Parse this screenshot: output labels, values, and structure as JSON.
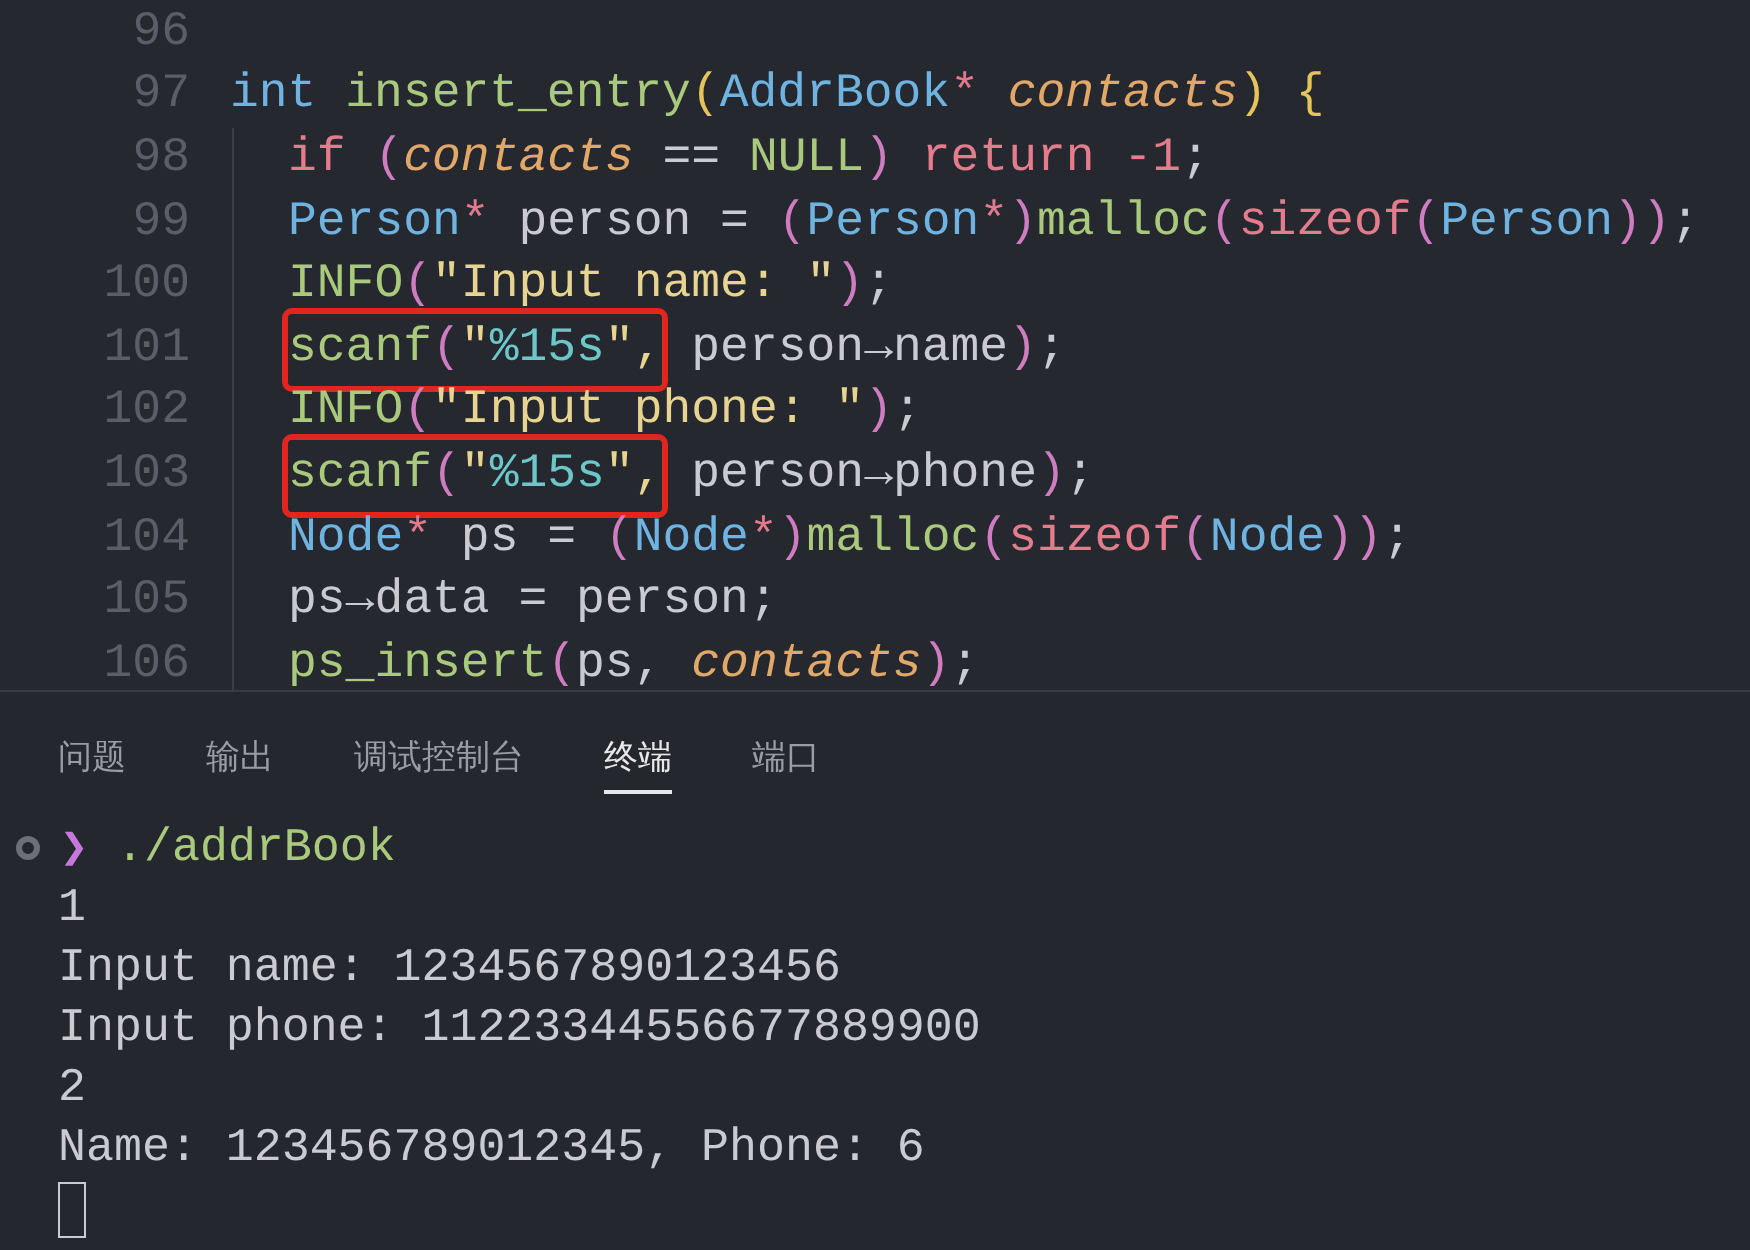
{
  "editor": {
    "lines": [
      {
        "number": "96",
        "boxed": false
      },
      {
        "number": "97",
        "boxed": false,
        "tokens": [
          {
            "text": "int ",
            "kind": "type"
          },
          {
            "text": "insert_entry",
            "kind": "fn"
          },
          {
            "text": "(",
            "kind": "bracket"
          },
          {
            "text": "AddrBook",
            "kind": "type"
          },
          {
            "text": "* ",
            "kind": "op"
          },
          {
            "text": "contacts",
            "kind": "param"
          },
          {
            "text": ") {",
            "kind": "bracket"
          }
        ],
        "children": [
          {
            "number": "98",
            "boxed": false,
            "tokens": [
              {
                "text": "if ",
                "kind": "keyword"
              },
              {
                "text": "(",
                "kind": "paren"
              },
              {
                "text": "contacts",
                "kind": "param"
              },
              {
                "text": " == ",
                "kind": "plain"
              },
              {
                "text": "NULL",
                "kind": "fn"
              },
              {
                "text": ") ",
                "kind": "paren"
              },
              {
                "text": "return -1",
                "kind": "keyword"
              },
              {
                "text": ";",
                "kind": "plain"
              }
            ]
          },
          {
            "number": "99",
            "boxed": false,
            "tokens": [
              {
                "text": "Person",
                "kind": "type"
              },
              {
                "text": "* ",
                "kind": "op"
              },
              {
                "text": "person = ",
                "kind": "plain"
              },
              {
                "text": "(",
                "kind": "paren"
              },
              {
                "text": "Person",
                "kind": "type"
              },
              {
                "text": "*",
                "kind": "op"
              },
              {
                "text": ")",
                "kind": "paren"
              },
              {
                "text": "malloc",
                "kind": "fn"
              },
              {
                "text": "(",
                "kind": "paren"
              },
              {
                "text": "sizeof",
                "kind": "keyword"
              },
              {
                "text": "(",
                "kind": "paren"
              },
              {
                "text": "Person",
                "kind": "type"
              },
              {
                "text": "))",
                "kind": "paren"
              },
              {
                "text": ";",
                "kind": "plain"
              }
            ]
          },
          {
            "number": "100",
            "boxed": false,
            "tokens": [
              {
                "text": "INFO",
                "kind": "fn"
              },
              {
                "text": "(",
                "kind": "paren"
              },
              {
                "text": "\"Input name: \"",
                "kind": "string"
              },
              {
                "text": ")",
                "kind": "paren"
              },
              {
                "text": ";",
                "kind": "plain"
              }
            ]
          },
          {
            "number": "101",
            "boxed": true,
            "boxed_tokens": [
              {
                "text": "scanf",
                "kind": "fn"
              },
              {
                "text": "(",
                "kind": "paren"
              },
              {
                "text": "\"",
                "kind": "string"
              },
              {
                "text": "%15s",
                "kind": "format"
              },
              {
                "text": "\",",
                "kind": "string"
              }
            ],
            "tokens": [
              {
                "text": " person→name",
                "kind": "plain"
              },
              {
                "text": ")",
                "kind": "paren"
              },
              {
                "text": ";",
                "kind": "plain"
              }
            ]
          },
          {
            "number": "102",
            "boxed": false,
            "tokens": [
              {
                "text": "INFO",
                "kind": "fn"
              },
              {
                "text": "(",
                "kind": "paren"
              },
              {
                "text": "\"Input phone: \"",
                "kind": "string"
              },
              {
                "text": ")",
                "kind": "paren"
              },
              {
                "text": ";",
                "kind": "plain"
              }
            ]
          },
          {
            "number": "103",
            "boxed": true,
            "boxed_tokens": [
              {
                "text": "scanf",
                "kind": "fn"
              },
              {
                "text": "(",
                "kind": "paren"
              },
              {
                "text": "\"",
                "kind": "string"
              },
              {
                "text": "%15s",
                "kind": "format"
              },
              {
                "text": "\",",
                "kind": "string"
              }
            ],
            "tokens": [
              {
                "text": " person→phone",
                "kind": "plain"
              },
              {
                "text": ")",
                "kind": "paren"
              },
              {
                "text": ";",
                "kind": "plain"
              }
            ]
          },
          {
            "number": "104",
            "boxed": false,
            "tokens": [
              {
                "text": "Node",
                "kind": "type"
              },
              {
                "text": "* ",
                "kind": "op"
              },
              {
                "text": "ps = ",
                "kind": "plain"
              },
              {
                "text": "(",
                "kind": "paren"
              },
              {
                "text": "Node",
                "kind": "type"
              },
              {
                "text": "*",
                "kind": "op"
              },
              {
                "text": ")",
                "kind": "paren"
              },
              {
                "text": "malloc",
                "kind": "fn"
              },
              {
                "text": "(",
                "kind": "paren"
              },
              {
                "text": "sizeof",
                "kind": "keyword"
              },
              {
                "text": "(",
                "kind": "paren"
              },
              {
                "text": "Node",
                "kind": "type"
              },
              {
                "text": "))",
                "kind": "paren"
              },
              {
                "text": ";",
                "kind": "plain"
              }
            ]
          },
          {
            "number": "105",
            "boxed": false,
            "tokens": [
              {
                "text": "ps→data = person;",
                "kind": "plain"
              }
            ]
          },
          {
            "number": "106",
            "boxed": false,
            "tokens": [
              {
                "text": "ps_insert",
                "kind": "fn"
              },
              {
                "text": "(",
                "kind": "paren"
              },
              {
                "text": "ps, ",
                "kind": "plain"
              },
              {
                "text": "contacts",
                "kind": "param"
              },
              {
                "text": ")",
                "kind": "paren"
              },
              {
                "text": ";",
                "kind": "plain"
              }
            ]
          }
        ]
      }
    ]
  },
  "panel": {
    "tabs": [
      {
        "label": "问题",
        "selected": false
      },
      {
        "label": "输出",
        "selected": false
      },
      {
        "label": "调试控制台",
        "selected": false
      },
      {
        "label": "终端",
        "selected": true
      },
      {
        "label": "端口",
        "selected": false
      }
    ]
  },
  "terminal": {
    "prompt_symbol": "❯",
    "command": "./addrBook",
    "output": [
      "1",
      "Input name: 1234567890123456",
      "Input phone: 11223344556677889900",
      "2",
      "Name: 123456789012345, Phone: 6"
    ]
  }
}
